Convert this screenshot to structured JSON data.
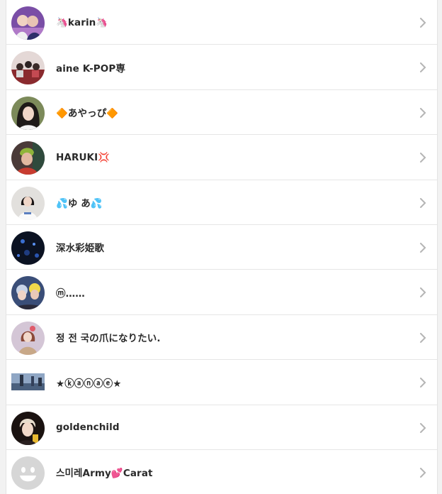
{
  "contacts": [
    {
      "name": "🦄karin🦄",
      "avatar": "avatar-photo-couple-purple"
    },
    {
      "name": "aine K-POP専",
      "avatar": "avatar-photo-group-red"
    },
    {
      "name": "🔶あやっぴ🔶",
      "avatar": "avatar-photo-woman-green"
    },
    {
      "name": "HARUKI💢",
      "avatar": "avatar-photo-man-red"
    },
    {
      "name": "💦ゆ あ💦",
      "avatar": "avatar-photo-girl-white"
    },
    {
      "name": "深水彩姫歌",
      "avatar": "avatar-photo-dark-stage"
    },
    {
      "name": "ⓜ……",
      "avatar": "avatar-photo-two-boys"
    },
    {
      "name": "정 전 국の爪になりたい.",
      "avatar": "avatar-photo-girl-pink"
    },
    {
      "name": "★ⓚⓐⓝⓐⓔ★",
      "avatar": "avatar-photo-stage-blue"
    },
    {
      "name": "goldenchild",
      "avatar": "avatar-photo-boy-dark"
    },
    {
      "name": "스미레Army💕Carat",
      "avatar": "avatar-default-face"
    }
  ],
  "colors": {
    "background": "#f2f2f2",
    "row": "#ffffff",
    "divider": "#e6e6e6",
    "text": "#2a2a2a",
    "chevron": "#b5b5b5"
  }
}
